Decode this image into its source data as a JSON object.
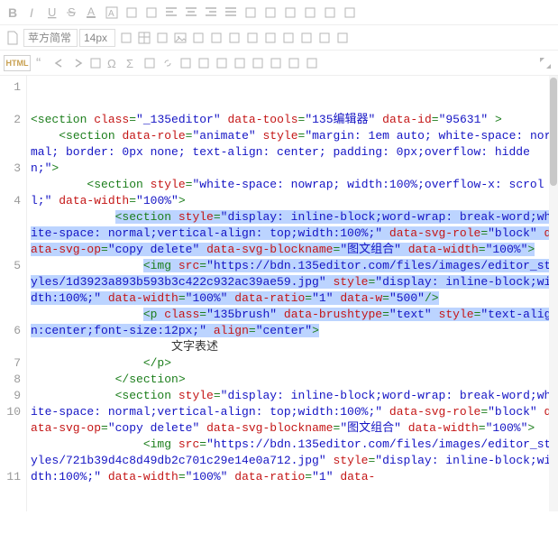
{
  "toolbar": {
    "row1_icons": [
      "bold",
      "italic",
      "underline",
      "strike",
      "font-color",
      "bg-color",
      "format-brush",
      "clear-format",
      "align-left",
      "align-center",
      "align-right",
      "align-justify",
      "indent-left",
      "indent-right",
      "line-height",
      "para-before",
      "para-after",
      "more-menu"
    ],
    "row2": {
      "new_doc": "new-doc",
      "font_family_value": "苹方简常",
      "font_size_value": "14px",
      "icons": [
        "font-case",
        "table",
        "code-block",
        "image",
        "video",
        "divider",
        "audio",
        "media",
        "film",
        "color-picker",
        "eyedropper",
        "emoji",
        "expand"
      ]
    },
    "row3": {
      "html_label": "HTML",
      "icons": [
        "quote",
        "undo",
        "redo",
        "find",
        "omega",
        "sigma",
        "hr",
        "link",
        "unlink",
        "anchor",
        "paste",
        "paste-word",
        "copy",
        "cut",
        "select-all",
        "expand"
      ]
    }
  },
  "gutter": [
    "1",
    "2",
    "3",
    "4",
    "5",
    "6",
    "7",
    "8",
    "9",
    "10",
    "11"
  ],
  "gutter_heights": {
    "1": "tall",
    "2": "three",
    "3": "tall",
    "4": "four",
    "5": "four",
    "6": "tall",
    "7": "",
    "8": "",
    "9": "",
    "10": "four",
    "11": "four"
  },
  "code": {
    "l1": {
      "ind": "",
      "p": [
        [
          "tag",
          "<section "
        ],
        [
          "attr",
          "class"
        ],
        [
          "tag",
          "="
        ],
        [
          "val",
          "\"_135editor\""
        ],
        [
          "tag",
          " "
        ],
        [
          "attr",
          "data-tools"
        ],
        [
          "tag",
          "="
        ],
        [
          "val",
          "\"135编辑器\""
        ],
        [
          "tag",
          " "
        ],
        [
          "attr",
          "data-id"
        ],
        [
          "tag",
          "="
        ],
        [
          "val",
          "\"95631\""
        ],
        [
          "tag",
          " >"
        ]
      ]
    },
    "l2": {
      "ind": "    ",
      "p": [
        [
          "tag",
          "<section "
        ],
        [
          "attr",
          "data-role"
        ],
        [
          "tag",
          "="
        ],
        [
          "val",
          "\"animate\""
        ],
        [
          "tag",
          " "
        ],
        [
          "attr",
          "style"
        ],
        [
          "tag",
          "="
        ],
        [
          "val",
          "\"margin: 1em auto; white-space: normal; border: 0px none; text-align: center; padding: 0px;overflow: hidden;\""
        ],
        [
          "tag",
          ">"
        ]
      ]
    },
    "l3": {
      "ind": "        ",
      "p": [
        [
          "tag",
          "<section "
        ],
        [
          "attr",
          "style"
        ],
        [
          "tag",
          "="
        ],
        [
          "val",
          "\"white-space: nowrap; width:100%;overflow-x: scroll;\""
        ],
        [
          "tag",
          " "
        ],
        [
          "attr",
          "data-width"
        ],
        [
          "tag",
          "="
        ],
        [
          "val",
          "\"100%\""
        ],
        [
          "tag",
          ">"
        ]
      ]
    },
    "l4": {
      "ind": "            ",
      "sel": true,
      "p": [
        [
          "tag",
          "<section "
        ],
        [
          "attr",
          "style"
        ],
        [
          "tag",
          "="
        ],
        [
          "val",
          "\"display: inline-block;word-wrap: break-word;white-space: normal;vertical-align: top;width:100%;\""
        ],
        [
          "tag",
          " "
        ],
        [
          "attr",
          "data-svg-role"
        ],
        [
          "tag",
          "="
        ],
        [
          "val",
          "\"block\""
        ],
        [
          "tag",
          " "
        ],
        [
          "attr",
          "data-svg-op"
        ],
        [
          "tag",
          "="
        ],
        [
          "val",
          "\"copy delete\""
        ],
        [
          "tag",
          " "
        ],
        [
          "attr",
          "data-svg-blockname"
        ],
        [
          "tag",
          "="
        ],
        [
          "val",
          "\"图文组合\""
        ],
        [
          "tag",
          " "
        ],
        [
          "attr",
          "data-width"
        ],
        [
          "tag",
          "="
        ],
        [
          "val",
          "\"100%\""
        ],
        [
          "tag",
          ">"
        ]
      ]
    },
    "l5": {
      "ind": "                ",
      "sel": true,
      "p": [
        [
          "tag",
          "<img "
        ],
        [
          "attr",
          "src"
        ],
        [
          "tag",
          "="
        ],
        [
          "val",
          "\"https://bdn.135editor.com/files/images/editor_styles/1d3923a893b593b3c422c932ac39ae59.jpg\""
        ],
        [
          "tag",
          " "
        ],
        [
          "attr",
          "style"
        ],
        [
          "tag",
          "="
        ],
        [
          "val",
          "\"display: inline-block;width:100%;\""
        ],
        [
          "tag",
          " "
        ],
        [
          "attr",
          "data-width"
        ],
        [
          "tag",
          "="
        ],
        [
          "val",
          "\"100%\""
        ],
        [
          "tag",
          " "
        ],
        [
          "attr",
          "data-ratio"
        ],
        [
          "tag",
          "="
        ],
        [
          "val",
          "\"1\""
        ],
        [
          "tag",
          " "
        ],
        [
          "attr",
          "data-w"
        ],
        [
          "tag",
          "="
        ],
        [
          "val",
          "\"500\""
        ],
        [
          "tag",
          "/>"
        ]
      ]
    },
    "l6": {
      "ind": "                ",
      "sel": true,
      "p": [
        [
          "tag",
          "<p "
        ],
        [
          "attr",
          "class"
        ],
        [
          "tag",
          "="
        ],
        [
          "val",
          "\"135brush\""
        ],
        [
          "tag",
          " "
        ],
        [
          "attr",
          "data-brushtype"
        ],
        [
          "tag",
          "="
        ],
        [
          "val",
          "\"text\""
        ],
        [
          "tag",
          " "
        ],
        [
          "attr",
          "style"
        ],
        [
          "tag",
          "="
        ],
        [
          "val",
          "\"text-align:center;font-size:12px;\""
        ],
        [
          "tag",
          " "
        ],
        [
          "attr",
          "align"
        ],
        [
          "tag",
          "="
        ],
        [
          "val",
          "\"center\""
        ],
        [
          "tag",
          ">"
        ]
      ]
    },
    "l7": {
      "ind": "                    ",
      "p": [
        [
          "txt",
          "文字表述"
        ]
      ]
    },
    "l8": {
      "ind": "                ",
      "p": [
        [
          "tag",
          "</p>"
        ]
      ]
    },
    "l9": {
      "ind": "            ",
      "p": [
        [
          "tag",
          "</section>"
        ]
      ]
    },
    "l10": {
      "ind": "            ",
      "p": [
        [
          "tag",
          "<section "
        ],
        [
          "attr",
          "style"
        ],
        [
          "tag",
          "="
        ],
        [
          "val",
          "\"display: inline-block;word-wrap: break-word;white-space: normal;vertical-align: top;width:100%;\""
        ],
        [
          "tag",
          " "
        ],
        [
          "attr",
          "data-svg-role"
        ],
        [
          "tag",
          "="
        ],
        [
          "val",
          "\"block\""
        ],
        [
          "tag",
          " "
        ],
        [
          "attr",
          "data-svg-op"
        ],
        [
          "tag",
          "="
        ],
        [
          "val",
          "\"copy delete\""
        ],
        [
          "tag",
          " "
        ],
        [
          "attr",
          "data-svg-blockname"
        ],
        [
          "tag",
          "="
        ],
        [
          "val",
          "\"图文组合\""
        ],
        [
          "tag",
          " "
        ],
        [
          "attr",
          "data-width"
        ],
        [
          "tag",
          "="
        ],
        [
          "val",
          "\"100%\""
        ],
        [
          "tag",
          ">"
        ]
      ]
    },
    "l11": {
      "ind": "                ",
      "p": [
        [
          "tag",
          "<img "
        ],
        [
          "attr",
          "src"
        ],
        [
          "tag",
          "="
        ],
        [
          "val",
          "\"https://bdn.135editor.com/files/images/editor_styles/721b39d4c8d49db2c701c29e14e0a712.jpg\""
        ],
        [
          "tag",
          " "
        ],
        [
          "attr",
          "style"
        ],
        [
          "tag",
          "="
        ],
        [
          "val",
          "\"display: inline-block;width:100%;\""
        ],
        [
          "tag",
          " "
        ],
        [
          "attr",
          "data-width"
        ],
        [
          "tag",
          "="
        ],
        [
          "val",
          "\"100%\""
        ],
        [
          "tag",
          " "
        ],
        [
          "attr",
          "data-ratio"
        ],
        [
          "tag",
          "="
        ],
        [
          "val",
          "\"1\""
        ],
        [
          "tag",
          " "
        ],
        [
          "attr",
          "data-"
        ]
      ]
    }
  }
}
